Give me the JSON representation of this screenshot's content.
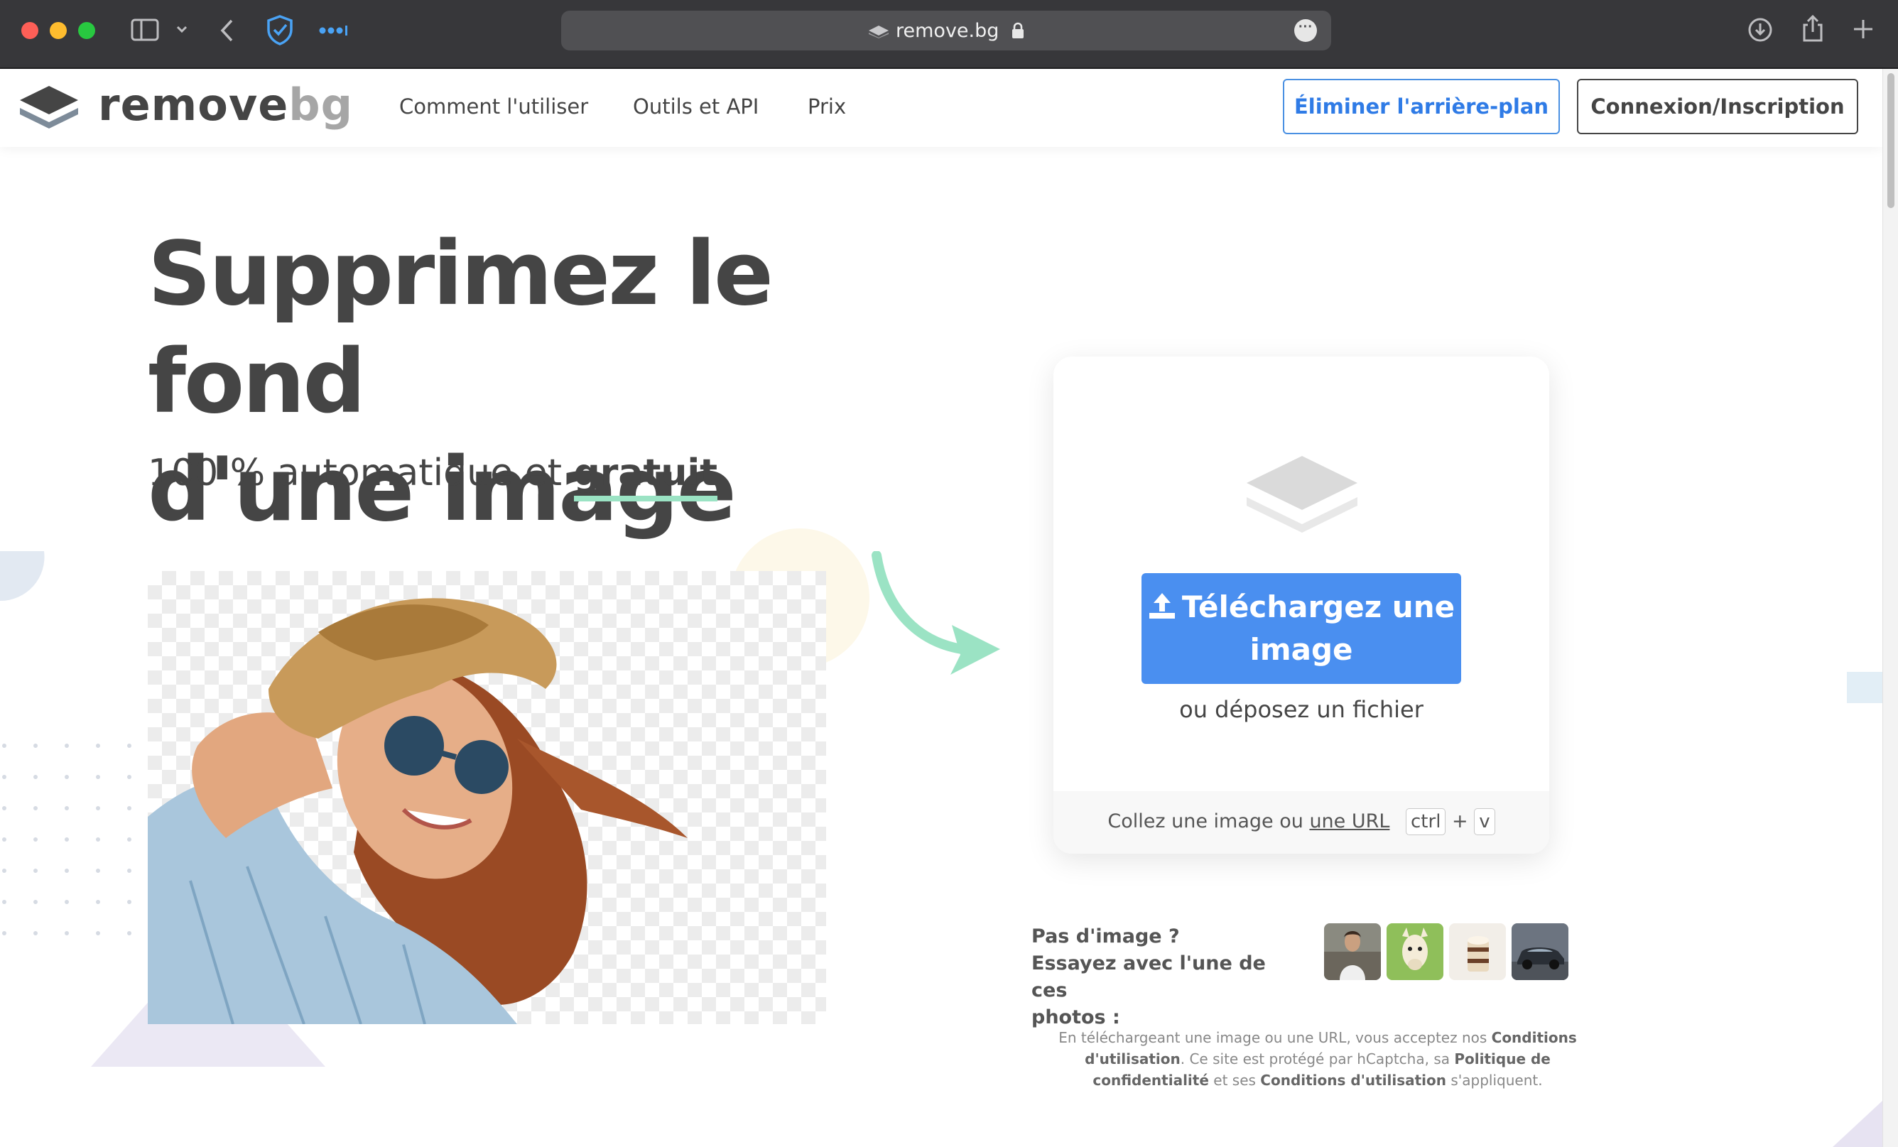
{
  "browser": {
    "url": "remove.bg"
  },
  "header": {
    "logo_main": "remove",
    "logo_accent": "bg",
    "nav": [
      "Comment l'utiliser",
      "Outils et API",
      "Prix"
    ],
    "cta_remove": "Éliminer l'arrière-plan",
    "cta_login": "Connexion/Inscription"
  },
  "hero": {
    "title_line1": "Supprimez le fond",
    "title_line2": "d'une image",
    "subtitle_prefix": "100 % automatique et ",
    "subtitle_highlight": "gratuit"
  },
  "upload": {
    "button_line1": "Téléchargez une",
    "button_line2": "image",
    "drop_text": "ou déposez un fichier",
    "paste_prefix": "Collez une image ou ",
    "paste_link": "une URL",
    "key_ctrl": "ctrl",
    "key_plus": "+",
    "key_v": "v"
  },
  "samples": {
    "line1": "Pas d'image ?",
    "line2": "Essayez avec l'une de ces",
    "line3": "photos :",
    "items": [
      "woman",
      "alpaca",
      "cake",
      "car"
    ]
  },
  "legal": {
    "p1": "En téléchargeant une image ou une URL, vous acceptez nos ",
    "terms1": "Conditions d'utilisation",
    "p2": ". Ce site est protégé par hCaptcha, sa ",
    "privacy": "Politique de confidentialité",
    "p3": " et ses ",
    "terms2": "Conditions d'utilisation",
    "p4": " s'appliquent."
  },
  "colors": {
    "brand_blue": "#4a8ff0",
    "text_dark": "#454545",
    "highlight_green": "#9be3c4"
  }
}
